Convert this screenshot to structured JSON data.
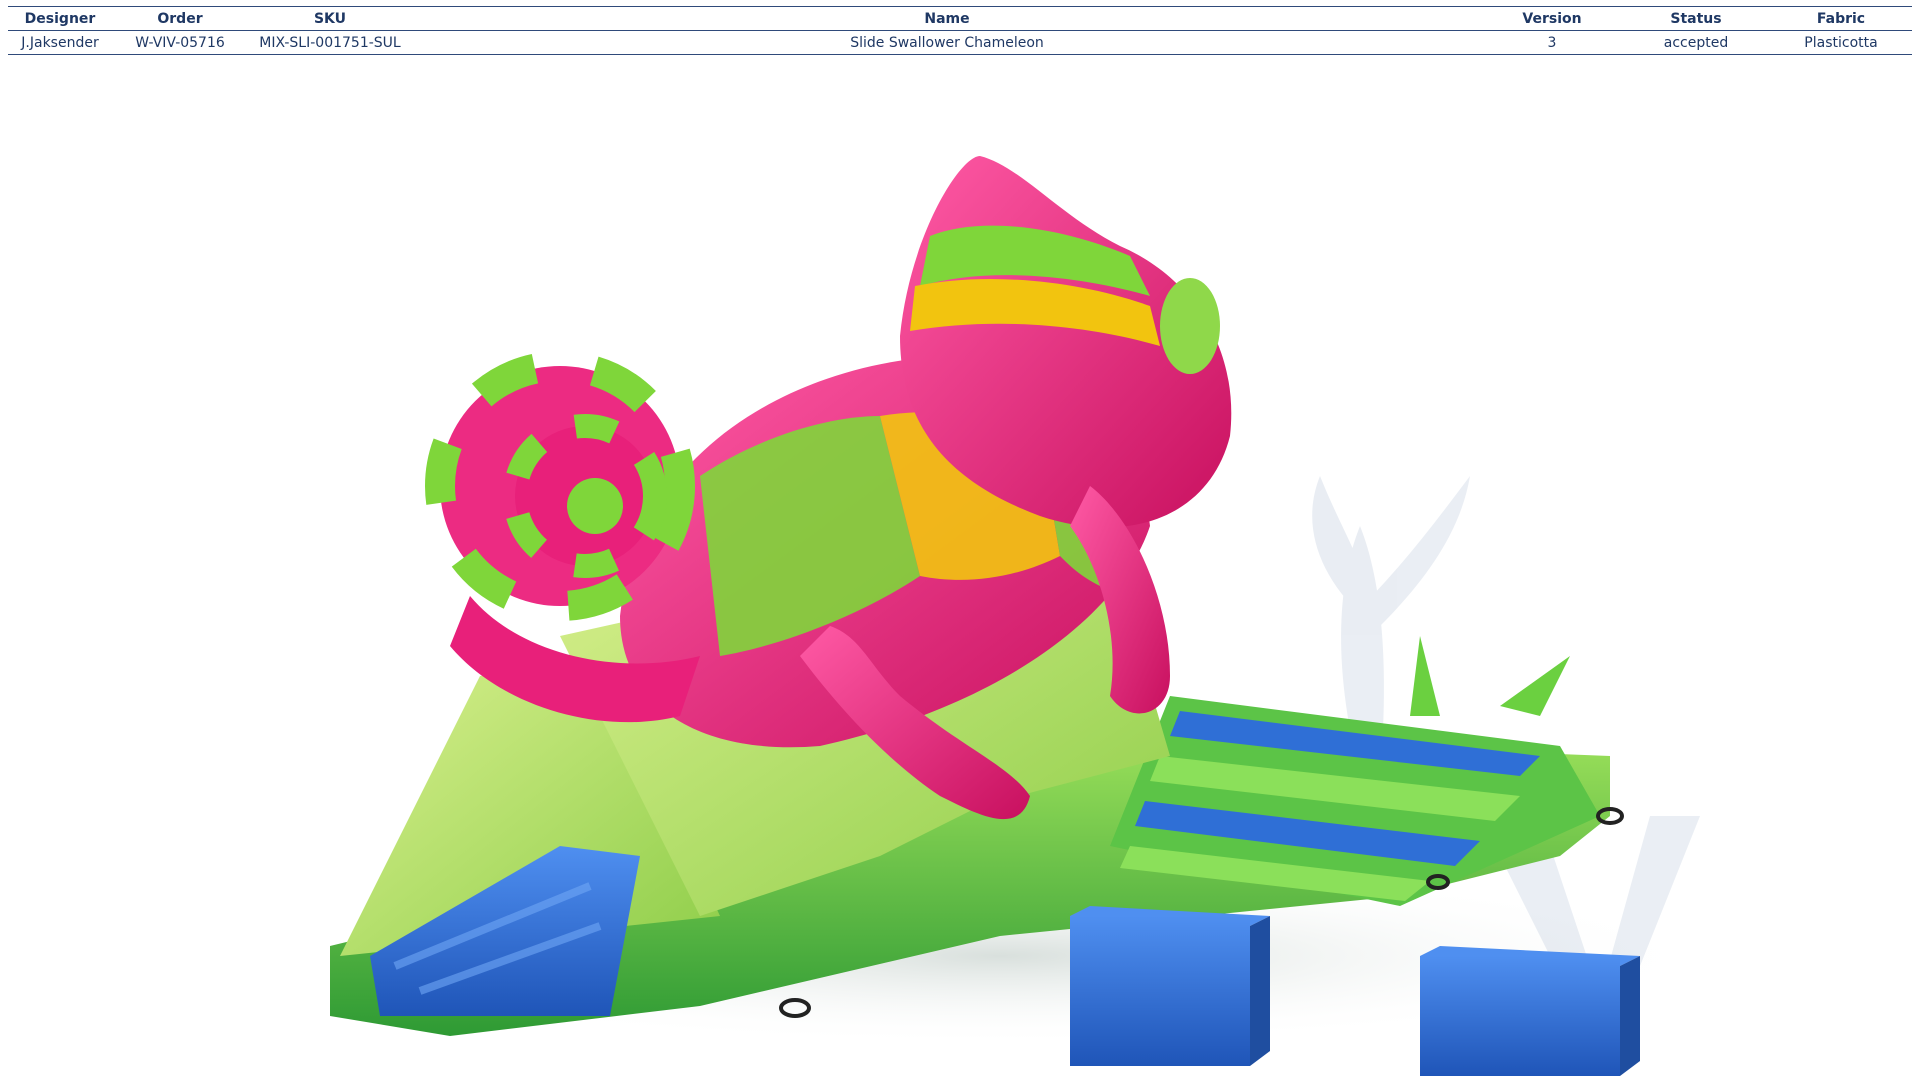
{
  "table": {
    "headers": {
      "designer": "Designer",
      "order": "Order",
      "sku": "SKU",
      "name": "Name",
      "version": "Version",
      "status": "Status",
      "fabric": "Fabric"
    },
    "row": {
      "designer": "J.Jaksender",
      "order": "W-VIV-05716",
      "sku": "MIX-SLI-001751-SUL",
      "name": "Slide Swallower Chameleon",
      "version": "3",
      "status": "accepted",
      "fabric": "Plasticotta"
    }
  },
  "render": {
    "subject": "inflatable-chameleon-slide",
    "colors": {
      "pink": "#e8207a",
      "lime": "#7fd63a",
      "yellow": "#f2c40f",
      "blue": "#2f6fd6",
      "pale_green": "#c9e87a",
      "dark_green": "#3aa83a"
    }
  }
}
